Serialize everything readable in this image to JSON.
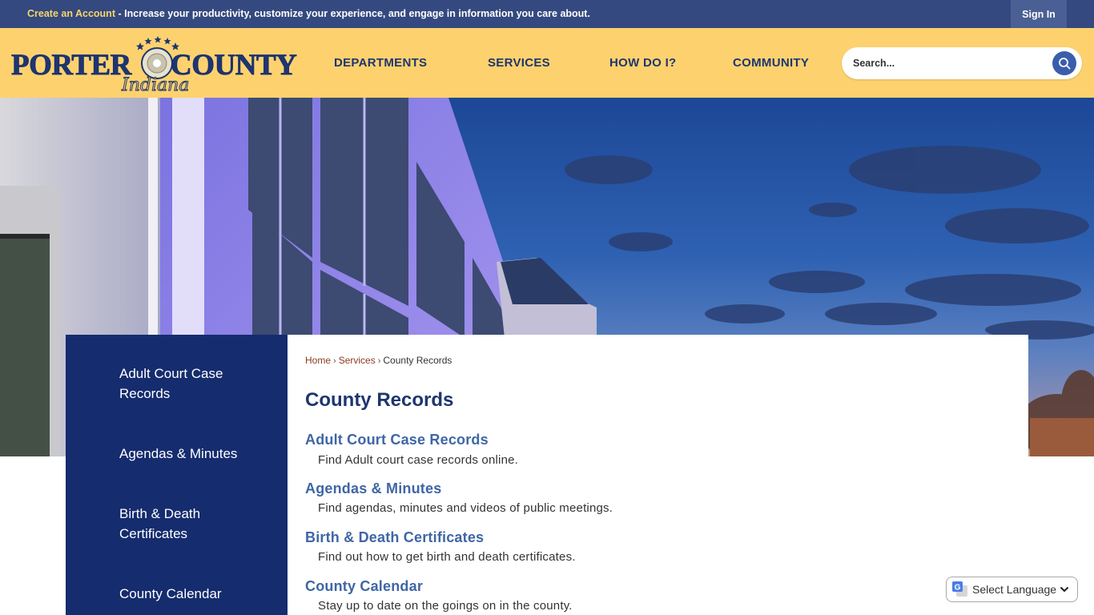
{
  "topbar": {
    "create_account": "Create an Account",
    "promo_text": " - Increase your productivity, customize your experience, and engage in information you care about.",
    "sign_in": "Sign In"
  },
  "header": {
    "logo_main": "PORTER COUNTY",
    "logo_sub": "Indiana",
    "nav": [
      "DEPARTMENTS",
      "SERVICES",
      "HOW DO I?",
      "COMMUNITY"
    ],
    "search_placeholder": "Search..."
  },
  "sidebar": {
    "items": [
      "Adult Court Case Records",
      "Agendas & Minutes",
      "Birth & Death Certificates",
      "County Calendar"
    ]
  },
  "breadcrumb": {
    "home": "Home",
    "services": "Services",
    "current": "County Records",
    "separator": "›"
  },
  "page_title": "County Records",
  "entries": [
    {
      "title": "Adult Court Case Records",
      "desc": "Find Adult court case records online."
    },
    {
      "title": "Agendas & Minutes",
      "desc": "Find agendas, minutes and videos of public meetings."
    },
    {
      "title": "Birth & Death Certificates",
      "desc": "Find out how to get birth and death certificates."
    },
    {
      "title": "County Calendar",
      "desc": "Stay up to date on the goings on in the county."
    }
  ],
  "translate": {
    "label": "Select Language"
  },
  "colors": {
    "topbar": "#34497f",
    "header": "#fdd26e",
    "nav_text": "#1f3570",
    "sidebar": "#152c6e",
    "link": "#3f66a5",
    "breadcrumb_link": "#8a3a1e"
  },
  "icons": [
    "search-icon",
    "google-translate-icon",
    "chevron-down-icon"
  ]
}
